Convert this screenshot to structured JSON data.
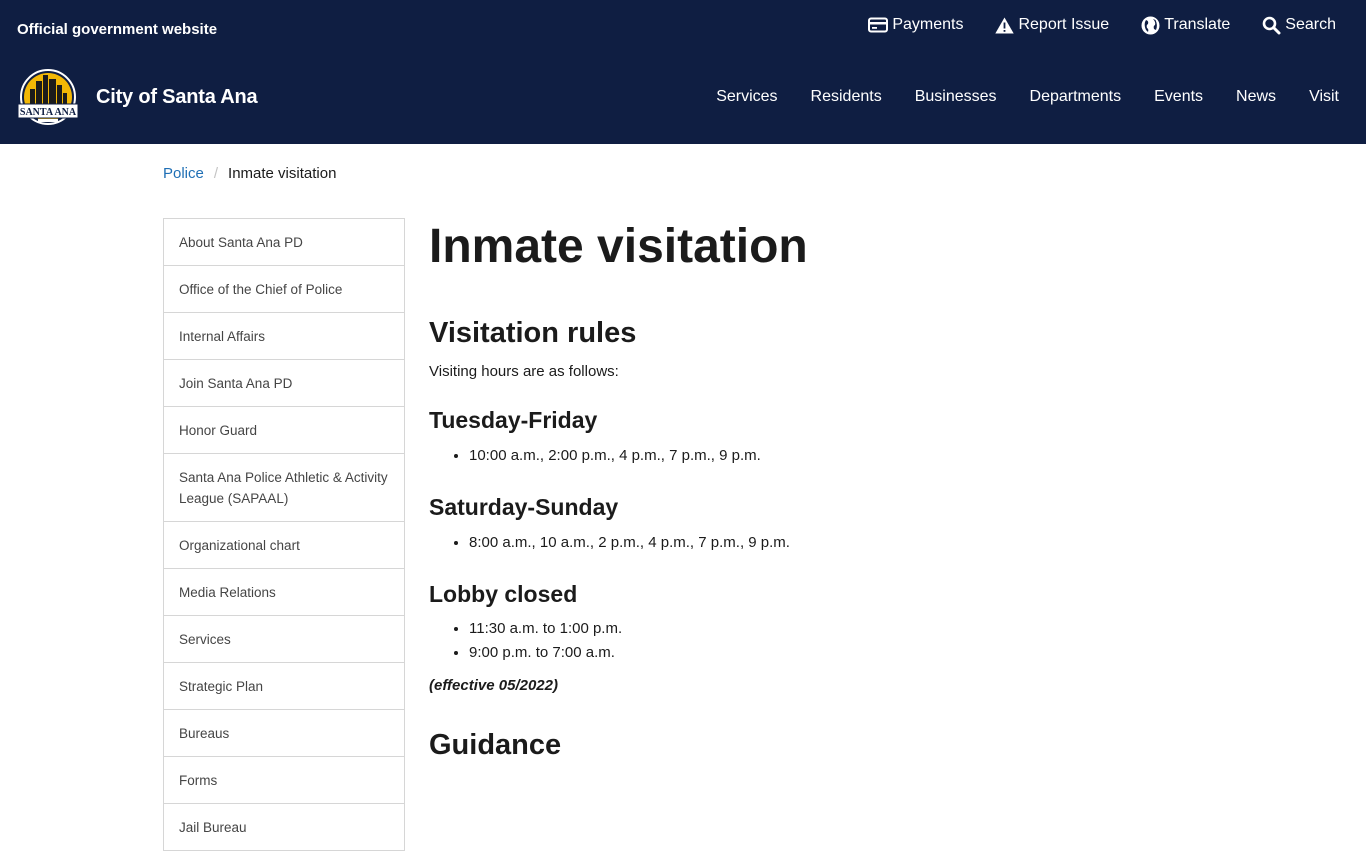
{
  "header": {
    "official": "Official government website",
    "utility": [
      {
        "label": "Payments",
        "icon": "credit-card-icon"
      },
      {
        "label": "Report Issue",
        "icon": "warning-icon"
      },
      {
        "label": "Translate",
        "icon": "globe-icon"
      },
      {
        "label": "Search",
        "icon": "search-icon"
      }
    ],
    "brand": "City of Santa Ana",
    "logo_text": "SANTA ANA",
    "nav": [
      "Services",
      "Residents",
      "Businesses",
      "Departments",
      "Events",
      "News",
      "Visit"
    ],
    "colors": {
      "background": "#0f1e42",
      "logo_gold": "#f2b705"
    }
  },
  "breadcrumb": {
    "parent": "Police",
    "current": "Inmate visitation"
  },
  "sidebar": {
    "items": [
      "About Santa Ana PD",
      "Office of the Chief of Police",
      "Internal Affairs",
      "Join Santa Ana PD",
      "Honor Guard",
      "Santa Ana Police Athletic & Activity League (SAPAAL)",
      "Organizational chart",
      "Media Relations",
      "Services",
      "Strategic Plan",
      "Bureaus",
      "Forms",
      "Jail Bureau"
    ]
  },
  "main": {
    "title": "Inmate visitation",
    "section1": "Visitation rules",
    "intro": "Visiting hours are as follows:",
    "weekday_heading": "Tuesday-Friday",
    "weekday_times": [
      "10:00 a.m., 2:00 p.m., 4 p.m., 7 p.m., 9 p.m."
    ],
    "weekend_heading": "Saturday-Sunday",
    "weekend_times": [
      "8:00 a.m., 10 a.m., 2 p.m., 4 p.m., 7 p.m., 9 p.m."
    ],
    "lobby_heading": "Lobby closed",
    "lobby_times": [
      "11:30 a.m. to 1:00 p.m.",
      "9:00 p.m. to 7:00 a.m."
    ],
    "effective": "(effective 05/2022)",
    "section2": "Guidance"
  }
}
